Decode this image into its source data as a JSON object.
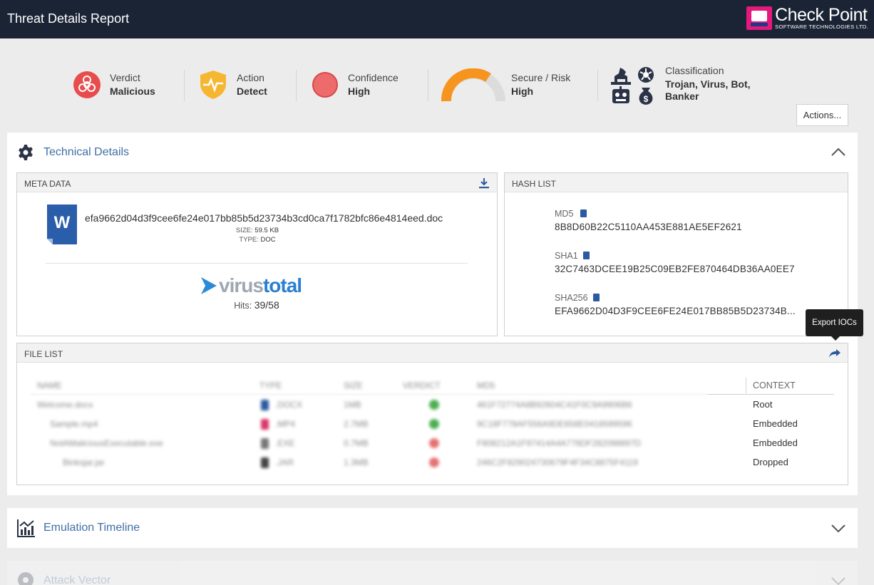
{
  "header": {
    "title": "Threat Details Report",
    "logo_name": "Check Point",
    "logo_sub": "SOFTWARE TECHNOLOGIES LTD."
  },
  "summary": {
    "verdict": {
      "label": "Verdict",
      "value": "Malicious"
    },
    "action": {
      "label": "Action",
      "value": "Detect"
    },
    "confidence": {
      "label": "Confidence",
      "value": "High"
    },
    "risk": {
      "label": "Secure / Risk",
      "value": "High"
    },
    "classification": {
      "label": "Classification",
      "value_line1": "Trojan, Virus, Bot,",
      "value_line2": "Banker"
    }
  },
  "actions_label": "Actions...",
  "technical": {
    "title": "Technical Details",
    "meta": {
      "header": "META DATA",
      "file_name": "efa9662d04d3f9cee6fe24e017bb85b5d23734b3cd0ca7f1782bfc86e4814eed.doc",
      "size_label": "SIZE:",
      "size_value": "59.5 KB",
      "type_label": "TYPE:",
      "type_value": "DOC",
      "doc_letter": "W",
      "vt_virus": "virus",
      "vt_total": "total",
      "hits_label": "Hits:",
      "hits_value": "39/58"
    },
    "hash": {
      "header": "HASH LIST",
      "md5_label": "MD5",
      "md5": "8B8D60B22C5110AA453E881AE5EF2621",
      "sha1_label": "SHA1",
      "sha1": "32C7463DCEE19B25C09EB2FE870464DB36AA0EE7",
      "sha256_label": "SHA256",
      "sha256": "EFA9662D04D3F9CEE6FE24E017BB85B5D23734B..."
    },
    "tooltip": "Export IOCs",
    "files": {
      "header": "FILE LIST",
      "columns": [
        "NAME",
        "TYPE",
        "SIZE",
        "VERDICT",
        "MD5",
        "CONTEXT"
      ],
      "rows": [
        {
          "name": "Welcome.docx",
          "type": ".DOCX",
          "size": "1MB",
          "md5": "461F72774A8B92604C41F0C9A9906B6",
          "context": "Root",
          "verdict_color": "#4caf50",
          "type_color": "#2b5aa0"
        },
        {
          "name": "Sample.mp4",
          "type": ".MP4",
          "size": "2.7MB",
          "md5": "9C18F778AF556A9DE658E0418599596",
          "context": "Embedded",
          "verdict_color": "#4caf50",
          "type_color": "#d9386a"
        },
        {
          "name": "NotAMaliciousExecutable.exe",
          "type": ".EXE",
          "size": "0.7MB",
          "md5": "F808212A1F97414A4A778DF282098897D",
          "context": "Embedded",
          "verdict_color": "#e57373",
          "type_color": "#777777"
        },
        {
          "name": "Binksjar.jar",
          "type": ".JAR",
          "size": "1.3MB",
          "md5": "246C2F829024730679F4F34C8875F4119",
          "context": "Dropped",
          "verdict_color": "#e57373",
          "type_color": "#444444"
        }
      ]
    }
  },
  "emulation": {
    "title": "Emulation Timeline"
  },
  "attack": {
    "title": "Attack Vector"
  }
}
